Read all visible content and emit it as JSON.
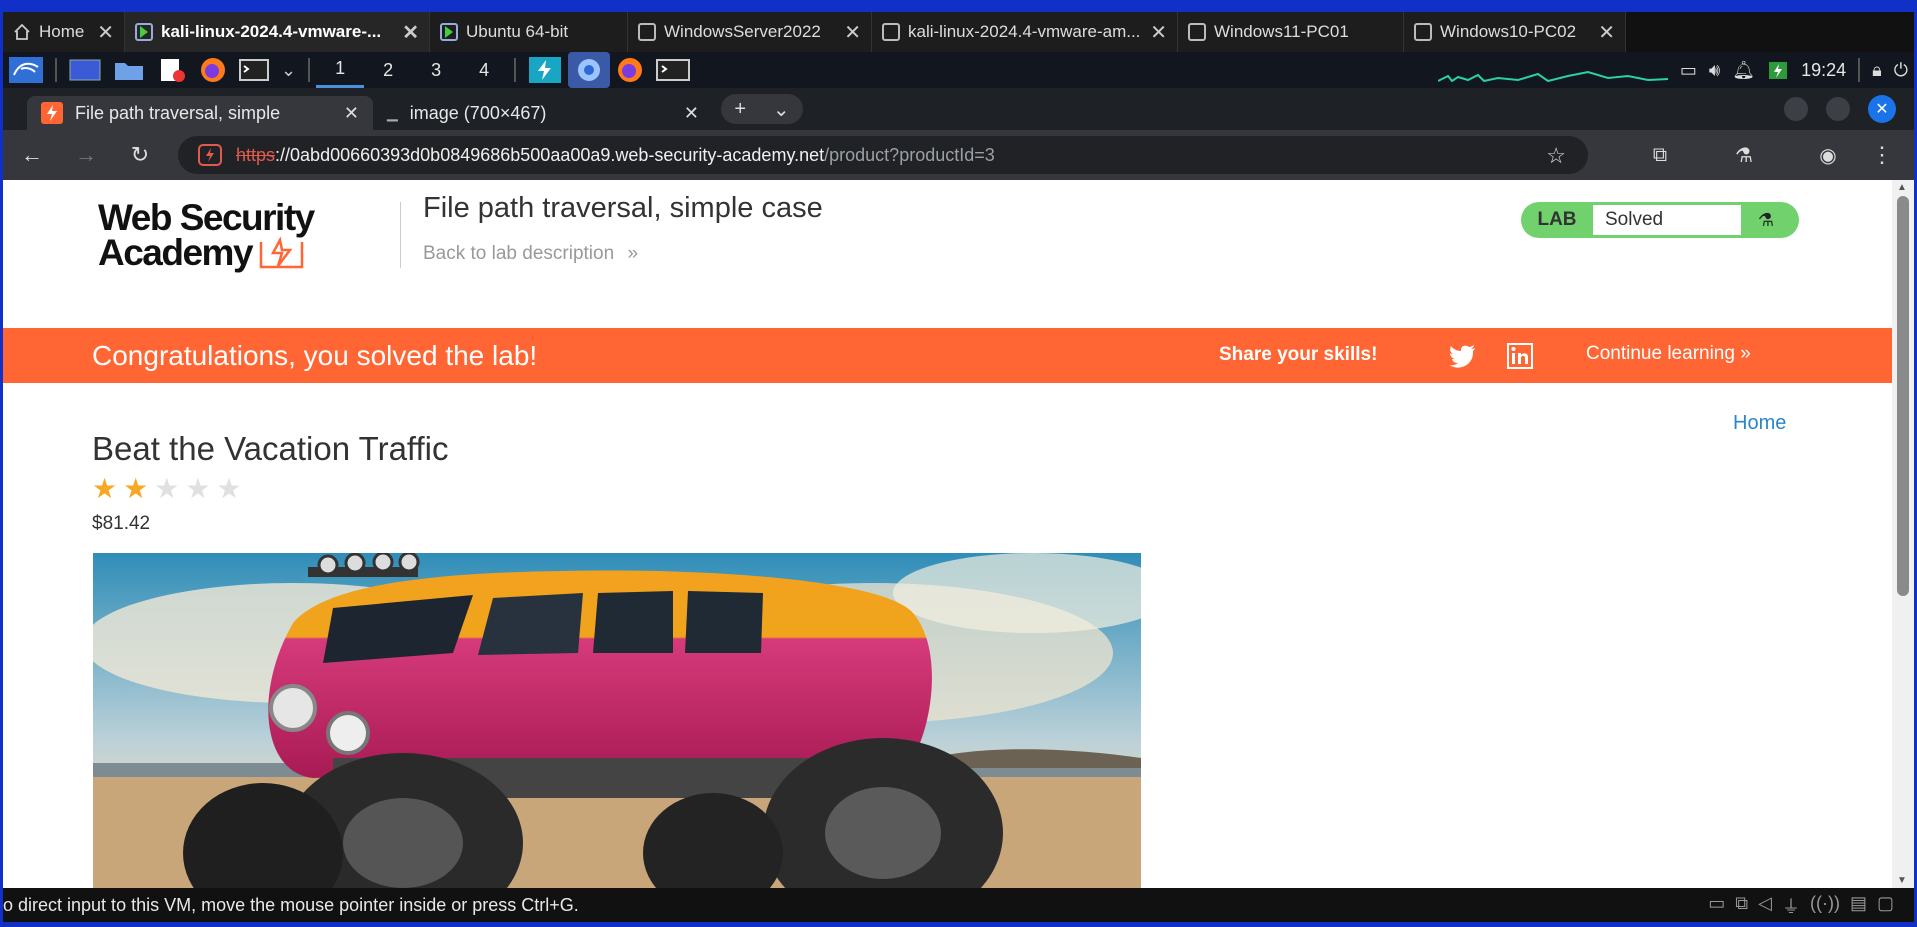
{
  "vm_tabs": [
    {
      "label": "Home",
      "icon": "home-icon",
      "active": false
    },
    {
      "label": "kali-linux-2024.4-vmware-...",
      "icon": "vm-running-icon",
      "active": true
    },
    {
      "label": "Ubuntu 64-bit",
      "icon": "vm-running-icon",
      "active": false
    },
    {
      "label": "WindowsServer2022",
      "icon": "vm-icon",
      "active": false
    },
    {
      "label": "kali-linux-2024.4-vmware-am...",
      "icon": "vm-icon",
      "active": false
    },
    {
      "label": "Windows11-PC01",
      "icon": "vm-icon",
      "active": false
    },
    {
      "label": "Windows10-PC02",
      "icon": "vm-icon",
      "active": false
    }
  ],
  "panel": {
    "workspaces": [
      "1",
      "2",
      "3",
      "4"
    ],
    "active_workspace": "1",
    "clock": "19:24"
  },
  "browser": {
    "tabs": [
      {
        "label": "File path traversal, simple",
        "active": true
      },
      {
        "label": "image (700×467)",
        "active": false
      }
    ],
    "url": {
      "scheme": "https",
      "host": "://0abd00660393d0b0849686b500aa00a9.web-security-academy.net",
      "path": "/product?productId=3"
    }
  },
  "header": {
    "logo_line1": "Web Security",
    "logo_line2": "Academy",
    "lab_title": "File path traversal, simple case",
    "back_link": "Back to lab description",
    "lab_badge": "LAB",
    "lab_status": "Solved"
  },
  "banner": {
    "message": "Congratulations, you solved the lab!",
    "share": "Share your skills!",
    "continue": "Continue learning"
  },
  "product": {
    "home_link": "Home",
    "name": "Beat the Vacation Traffic",
    "rating": 2,
    "rating_max": 5,
    "price": "$81.42"
  },
  "status_bar": {
    "text": "o direct input to this VM, move the mouse pointer inside or press Ctrl+G."
  },
  "colors": {
    "accent_orange": "#ff6633",
    "solved_green": "#70d16d",
    "link_blue": "#2a86c9"
  }
}
